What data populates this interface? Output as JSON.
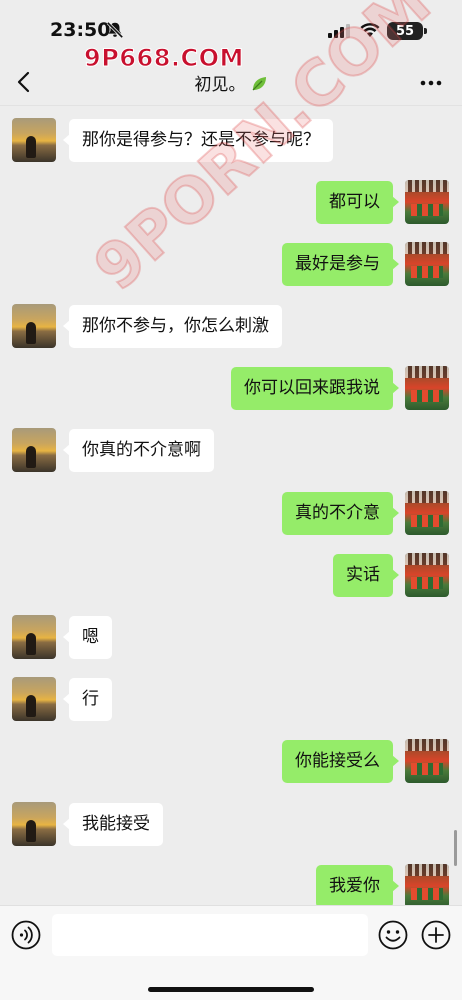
{
  "status_bar": {
    "time": "23:50",
    "battery": "55"
  },
  "watermarks": {
    "brand": "9P668.COM",
    "diagonal": "9PORN.COM"
  },
  "header": {
    "title": "初见。",
    "back_icon": "chevron-left-icon",
    "more_icon": "ellipsis-icon"
  },
  "messages": [
    {
      "side": "left",
      "text": "那你是得参与？还是不参与呢？"
    },
    {
      "side": "right",
      "text": "都可以"
    },
    {
      "side": "right",
      "text": "最好是参与"
    },
    {
      "side": "left",
      "text": "那你不参与，你怎么刺激"
    },
    {
      "side": "right",
      "text": "你可以回来跟我说"
    },
    {
      "side": "left",
      "text": "你真的不介意啊"
    },
    {
      "side": "right",
      "text": "真的不介意"
    },
    {
      "side": "right",
      "text": "实话"
    },
    {
      "side": "left",
      "text": "嗯"
    },
    {
      "side": "left",
      "text": "行"
    },
    {
      "side": "right",
      "text": "你能接受么"
    },
    {
      "side": "left",
      "text": "我能接受"
    },
    {
      "side": "right",
      "text": "我爱你"
    }
  ],
  "input_bar": {
    "value": "",
    "voice_icon": "voice-icon",
    "emoji_icon": "emoji-icon",
    "plus_icon": "plus-icon"
  },
  "colors": {
    "background": "#ededed",
    "bubble_sent": "#95ec69",
    "bubble_received": "#ffffff",
    "brand_watermark": "#c8102e"
  }
}
